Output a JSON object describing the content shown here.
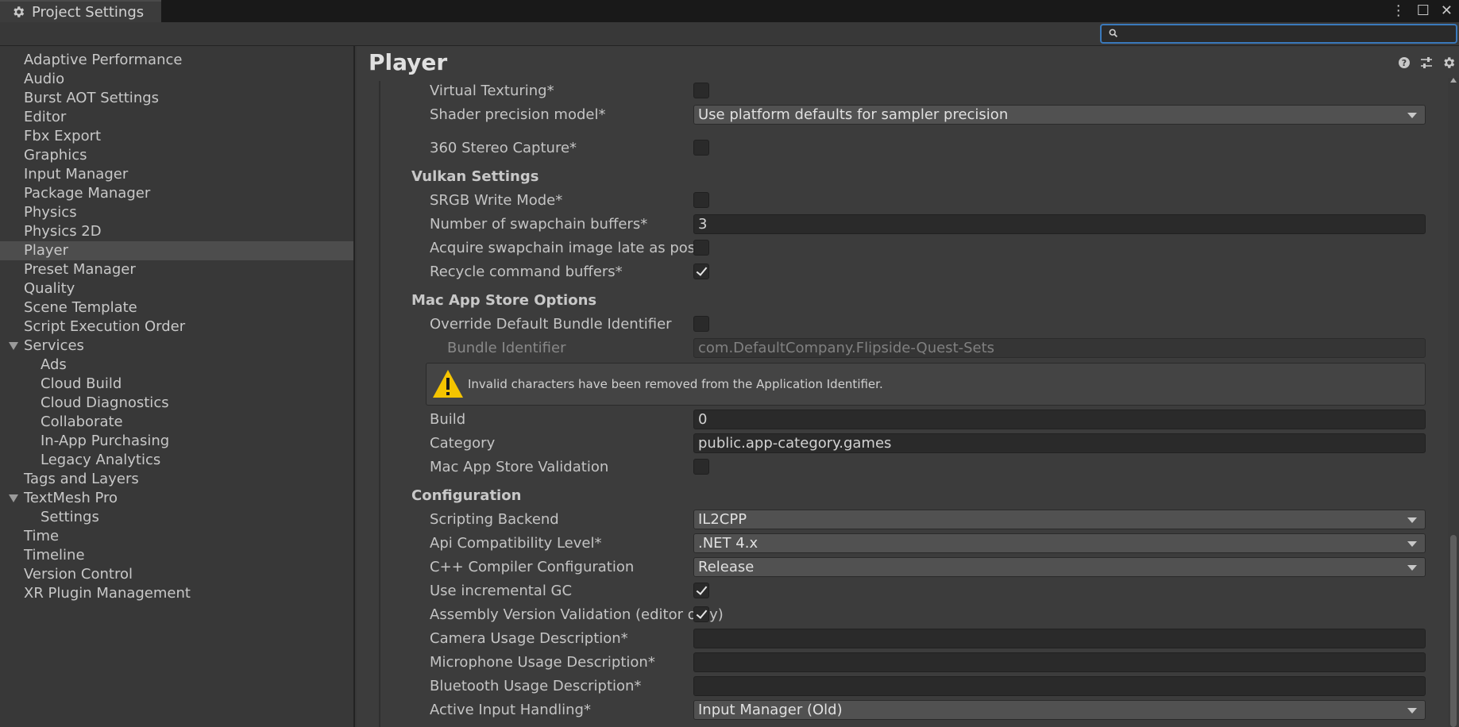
{
  "window": {
    "tab_label": "Project Settings"
  },
  "search": {
    "value": "",
    "placeholder": ""
  },
  "sidebar": {
    "items": [
      {
        "label": "Adaptive Performance"
      },
      {
        "label": "Audio"
      },
      {
        "label": "Burst AOT Settings"
      },
      {
        "label": "Editor"
      },
      {
        "label": "Fbx Export"
      },
      {
        "label": "Graphics"
      },
      {
        "label": "Input Manager"
      },
      {
        "label": "Package Manager"
      },
      {
        "label": "Physics"
      },
      {
        "label": "Physics 2D"
      },
      {
        "label": "Player"
      },
      {
        "label": "Preset Manager"
      },
      {
        "label": "Quality"
      },
      {
        "label": "Scene Template"
      },
      {
        "label": "Script Execution Order"
      },
      {
        "label": "Services"
      },
      {
        "label": "Ads"
      },
      {
        "label": "Cloud Build"
      },
      {
        "label": "Cloud Diagnostics"
      },
      {
        "label": "Collaborate"
      },
      {
        "label": "In-App Purchasing"
      },
      {
        "label": "Legacy Analytics"
      },
      {
        "label": "Tags and Layers"
      },
      {
        "label": "TextMesh Pro"
      },
      {
        "label": "Settings"
      },
      {
        "label": "Time"
      },
      {
        "label": "Timeline"
      },
      {
        "label": "Version Control"
      },
      {
        "label": "XR Plugin Management"
      }
    ]
  },
  "main": {
    "title": "Player",
    "rendering": {
      "virtual_texturing": {
        "label": "Virtual Texturing*",
        "checked": false
      },
      "shader_precision": {
        "label": "Shader precision model*",
        "value": "Use platform defaults for sampler precision"
      },
      "stereo_capture": {
        "label": "360 Stereo Capture*",
        "checked": false
      }
    },
    "vulkan": {
      "header": "Vulkan Settings",
      "srgb_write": {
        "label": "SRGB Write Mode*",
        "checked": false
      },
      "swapchain_buffers": {
        "label": "Number of swapchain buffers*",
        "value": "3"
      },
      "acquire_late": {
        "label": "Acquire swapchain image late as possible*",
        "checked": false
      },
      "recycle_buffers": {
        "label": "Recycle command buffers*",
        "checked": true
      }
    },
    "mac_app_store": {
      "header": "Mac App Store Options",
      "override_bundle": {
        "label": "Override Default Bundle Identifier",
        "checked": false
      },
      "bundle_identifier": {
        "label": "Bundle Identifier",
        "value": "com.DefaultCompany.Flipside-Quest-Sets"
      },
      "warning": "Invalid characters have been removed from the Application Identifier.",
      "build": {
        "label": "Build",
        "value": "0"
      },
      "category": {
        "label": "Category",
        "value": "public.app-category.games"
      },
      "validation": {
        "label": "Mac App Store Validation",
        "checked": false
      }
    },
    "configuration": {
      "header": "Configuration",
      "scripting_backend": {
        "label": "Scripting Backend",
        "value": "IL2CPP"
      },
      "api_level": {
        "label": "Api Compatibility Level*",
        "value": ".NET 4.x"
      },
      "cpp_config": {
        "label": "C++ Compiler Configuration",
        "value": "Release"
      },
      "incremental_gc": {
        "label": "Use incremental GC",
        "checked": true
      },
      "assembly_validation": {
        "label": "Assembly Version Validation (editor only)",
        "checked": true
      },
      "camera_usage": {
        "label": "Camera Usage Description*",
        "value": ""
      },
      "microphone_usage": {
        "label": "Microphone Usage Description*",
        "value": ""
      },
      "bluetooth_usage": {
        "label": "Bluetooth Usage Description*",
        "value": ""
      },
      "input_handling": {
        "label": "Active Input Handling*",
        "value": "Input Manager (Old)"
      }
    }
  },
  "colors": {
    "accent": "#3a79bb",
    "warning": "#f5c400",
    "panel": "#3c3c3c",
    "field": "#2a2a2a"
  },
  "icons": [
    "gear-icon",
    "more-menu-icon",
    "maximize-icon",
    "close-icon",
    "search-icon",
    "help-icon",
    "presets-icon",
    "settings-icon",
    "warning-icon",
    "chevron-down-icon",
    "checkmark-icon"
  ]
}
